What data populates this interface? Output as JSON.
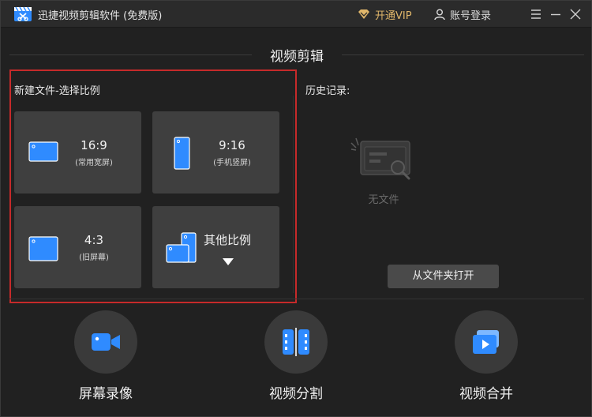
{
  "titlebar": {
    "title": "迅捷视频剪辑软件 (免费版)",
    "vip_label": "开通VIP",
    "account_label": "账号登录"
  },
  "section_title": "视频剪辑",
  "new_file": {
    "label": "新建文件-选择比例",
    "ratios": [
      {
        "ratio": "16:9",
        "desc": "(常用宽屏)"
      },
      {
        "ratio": "9:16",
        "desc": "(手机竖屏)"
      },
      {
        "ratio": "4:3",
        "desc": "(旧屏幕)"
      },
      {
        "ratio": "其他比例",
        "desc": ""
      }
    ]
  },
  "history": {
    "label": "历史记录:",
    "empty_text": "无文件",
    "open_folder_label": "从文件夹打开"
  },
  "tools": [
    {
      "label": "屏幕录像",
      "icon": "camera-icon"
    },
    {
      "label": "视频分割",
      "icon": "film-split-icon"
    },
    {
      "label": "视频合并",
      "icon": "video-merge-icon"
    }
  ],
  "colors": {
    "accent_blue": "#2f8bff",
    "vip_gold": "#e0b66a",
    "highlight_red": "#c62a2a"
  }
}
